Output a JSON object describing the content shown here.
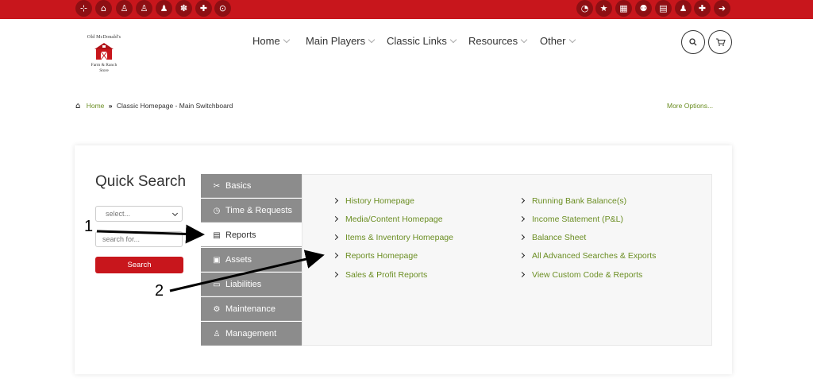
{
  "topbar": {
    "left_icons": [
      "sitemap-icon",
      "home-icon",
      "person-icon",
      "child-icon",
      "child-small-icon",
      "paw-icon",
      "puzzle-icon",
      "tractor-icon"
    ],
    "right_icons": [
      "gauge-icon",
      "star-icon",
      "building-icon",
      "users-icon",
      "calendar-icon",
      "user-icon",
      "user-plus-icon",
      "sign-out-icon"
    ],
    "color": "#c8161c"
  },
  "logo": {
    "line1": "Old McDonald's",
    "line2": "Farm & Ranch",
    "line3": "Store"
  },
  "nav": {
    "items": [
      {
        "label": "Home"
      },
      {
        "label": "Main Players"
      },
      {
        "label": "Classic Links"
      },
      {
        "label": "Resources"
      },
      {
        "label": "Other"
      }
    ],
    "search_icon": "search-icon",
    "cart_icon": "cart-icon"
  },
  "breadcrumb": {
    "home": "Home",
    "separator": "»",
    "current": "Classic Homepage - Main Switchboard",
    "more_options": "More Options..."
  },
  "quick_search": {
    "title": "Quick Search",
    "select_value": "select...",
    "input_placeholder": "search for...",
    "button_label": "Search"
  },
  "menu": {
    "items": [
      {
        "label": "Basics",
        "icon": "tools-icon",
        "active": false
      },
      {
        "label": "Time & Requests",
        "icon": "stopwatch-icon",
        "active": false
      },
      {
        "label": "Reports",
        "icon": "document-icon",
        "active": true
      },
      {
        "label": "Assets",
        "icon": "money-icon",
        "active": false
      },
      {
        "label": "Liabilities",
        "icon": "card-icon",
        "active": false
      },
      {
        "label": "Maintenance",
        "icon": "gear-icon",
        "active": false
      },
      {
        "label": "Management",
        "icon": "manager-icon",
        "active": false
      }
    ]
  },
  "reports_links": {
    "col1": [
      "History Homepage",
      "Media/Content Homepage",
      "Items & Inventory Homepage",
      "Reports Homepage",
      "Sales & Profit Reports"
    ],
    "col2": [
      "Running Bank Balance(s)",
      "Income Statement (P&L)",
      "Balance Sheet",
      "All Advanced Searches & Exports",
      "View Custom Code & Reports"
    ]
  },
  "annotations": {
    "label1": "1",
    "label2": "2"
  },
  "colors": {
    "accent_red": "#c8161c",
    "link_green": "#6b8e23",
    "menu_gray": "#8c8c8c"
  }
}
